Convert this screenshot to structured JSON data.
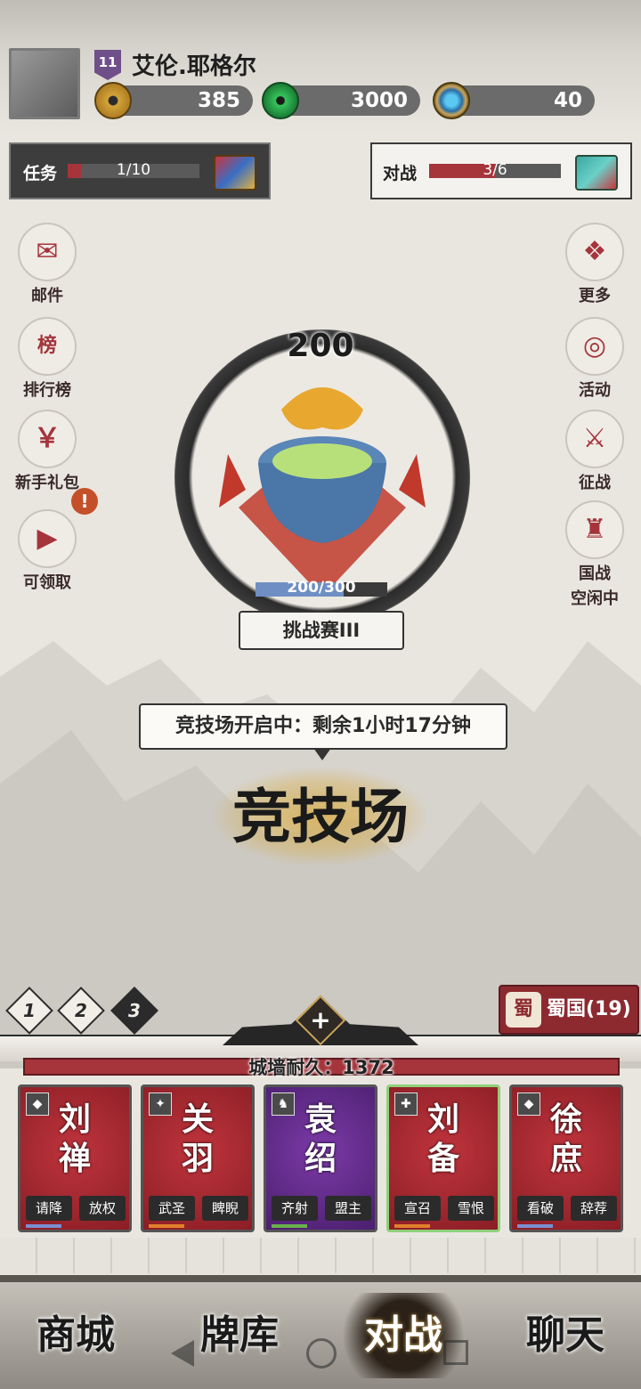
{
  "player": {
    "level": "11",
    "name": "艾伦.耶格尔"
  },
  "resources": {
    "coins": "385",
    "jade": "3000",
    "gems": "40"
  },
  "quests": {
    "task_label": "任务",
    "task_progress_text": "1/10",
    "task_progress": 0.1,
    "battle_label": "对战",
    "battle_progress_text": "3/6",
    "battle_progress": 0.5
  },
  "left_menu": [
    {
      "label": "邮件",
      "icon": "mail-icon",
      "glyph": "✉"
    },
    {
      "label": "排行榜",
      "icon": "ranking-icon",
      "glyph": "榜"
    },
    {
      "label": "新手礼包",
      "icon": "gift-bag-icon",
      "glyph": "￥"
    },
    {
      "label": "可领取",
      "icon": "claim-icon",
      "glyph": "▶"
    }
  ],
  "alert_badge": "!",
  "right_menu": [
    {
      "label": "更多",
      "icon": "more-icon",
      "glyph": "❖"
    },
    {
      "label": "活动",
      "icon": "event-icon",
      "glyph": "◎"
    },
    {
      "label": "征战",
      "icon": "crossed-swords-icon",
      "glyph": "⚔"
    },
    {
      "label": "国战",
      "sublabel": "空闲中",
      "icon": "fortress-icon",
      "glyph": "♜"
    }
  ],
  "arena": {
    "score": "200",
    "hp_text": "200/300",
    "hp_fraction": 0.667,
    "rank_name": "挑战赛III",
    "tooltip": "竞技场开启中：剩余1小时17分钟",
    "title": "竞技场"
  },
  "pages": [
    "1",
    "2",
    "3"
  ],
  "active_page": 2,
  "kingdom": {
    "icon_text": "蜀",
    "label": "蜀国(19)"
  },
  "wall": {
    "text": "城墙耐久：1372"
  },
  "cards": [
    {
      "name": "刘禅",
      "type_glyph": "◆",
      "skills": [
        "请降",
        "放权"
      ],
      "color": "red",
      "selected": false
    },
    {
      "name": "关羽",
      "type_glyph": "✦",
      "skills": [
        "武圣",
        "睥睨"
      ],
      "color": "red",
      "selected": false
    },
    {
      "name": "袁绍",
      "type_glyph": "♞",
      "skills": [
        "齐射",
        "盟主"
      ],
      "color": "purple",
      "selected": false
    },
    {
      "name": "刘备",
      "type_glyph": "✚",
      "skills": [
        "宣召",
        "雪恨"
      ],
      "color": "red",
      "selected": true
    },
    {
      "name": "徐庶",
      "type_glyph": "◆",
      "skills": [
        "看破",
        "辞荐"
      ],
      "color": "red",
      "selected": false
    }
  ],
  "nav": [
    {
      "label": "商城",
      "active": false
    },
    {
      "label": "牌库",
      "active": false
    },
    {
      "label": "对战",
      "active": true
    },
    {
      "label": "聊天",
      "active": false
    }
  ],
  "colors": {
    "accent_red": "#a5343b",
    "purple": "#6f4f8a",
    "gold": "#caa45a"
  }
}
